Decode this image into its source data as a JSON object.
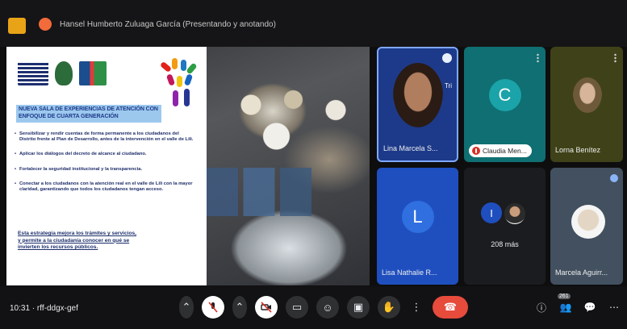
{
  "topbar": {
    "presenter_text": "Hansel Humberto Zuluaga García (Presentando y anotando)"
  },
  "slide": {
    "title": "NUEVA SALA DE EXPERIENCIAS DE ATENCIÓN CON ENFOQUE DE CUARTA GENERACIÓN",
    "bullets": [
      "Sensibilizar y rendir cuentas de forma permanente a los ciudadanos del Distrito frente al Plan de Desarrollo, antes de la intervención en el valle de Lili.",
      "Aplicar los diálogos del decreto de alcance al ciudadano.",
      "Fortalecer la seguridad institucional y la transparencia.",
      "Conectar a los ciudadanos con la atención real en el valle de Lili con la mayor claridad, garantizando que todos los ciudadanos tengan acceso."
    ],
    "footer": "Esta estrategia mejora los trámites y servicios, y permite a la ciudadanía conocer en qué se invierten los recursos públicos."
  },
  "tiles": [
    {
      "name": "Lina Marcela S...",
      "label": "Tri"
    },
    {
      "letter": "C",
      "name": "Claudia Men..."
    },
    {
      "name": "Lorna Benítez"
    },
    {
      "letter": "L",
      "name": "Lisa Nathalie R..."
    },
    {
      "letter": "I",
      "more": "208 más"
    },
    {
      "name": "Marcela Aguirr..."
    }
  ],
  "bottombar": {
    "clock": "10:31 · rff-ddgx-gef",
    "participants_count": "261"
  },
  "colors": {
    "end_call": "#e64b3c",
    "tile_blue": "#1f4fbf",
    "tile_teal": "#0f6f72",
    "tile_olive": "#3f4218"
  },
  "icons": {
    "mic": "mic-off-icon",
    "camera": "camera-off-icon",
    "captions": "captions-icon",
    "emoji": "emoji-icon",
    "present": "present-icon",
    "hand": "raise-hand-icon",
    "more": "more-icon",
    "end": "end-call-icon",
    "info": "info-icon",
    "people": "people-icon",
    "chat": "chat-icon",
    "activities": "activities-icon"
  }
}
